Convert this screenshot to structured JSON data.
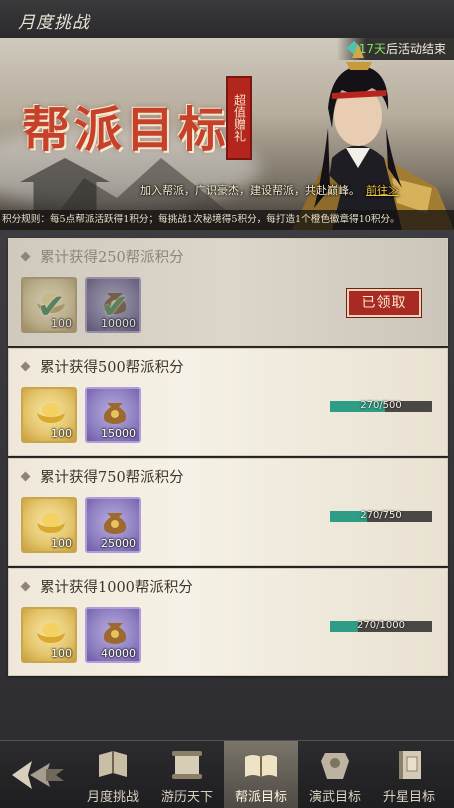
{
  "header": {
    "title": "月度挑战"
  },
  "banner": {
    "timer_days": "17天",
    "timer_text": "后活动结束",
    "title": "帮派目标",
    "seal": "超值赠礼",
    "slogan": "加入帮派，广识豪杰，建设帮派，共赴巅峰。",
    "goto": "前往≫",
    "rules": "积分规则：每5点帮派活跃得1积分；每挑战1次秘境得5积分，每打造1个橙色徽章得10积分。"
  },
  "tasks": [
    {
      "label": "累计获得250帮派积分",
      "rewards": [
        {
          "type": "gold",
          "qty": "100"
        },
        {
          "type": "bag",
          "qty": "10000"
        }
      ],
      "claimed": true,
      "claimed_text": "已领取"
    },
    {
      "label": "累计获得500帮派积分",
      "rewards": [
        {
          "type": "gold",
          "qty": "100"
        },
        {
          "type": "bag",
          "qty": "15000"
        }
      ],
      "claimed": false,
      "progress_text": "270/500",
      "progress": 0.54
    },
    {
      "label": "累计获得750帮派积分",
      "rewards": [
        {
          "type": "gold",
          "qty": "100"
        },
        {
          "type": "bag",
          "qty": "25000"
        }
      ],
      "claimed": false,
      "progress_text": "270/750",
      "progress": 0.36
    },
    {
      "label": "累计获得1000帮派积分",
      "rewards": [
        {
          "type": "gold",
          "qty": "100"
        },
        {
          "type": "bag",
          "qty": "40000"
        }
      ],
      "claimed": false,
      "progress_text": "270/1000",
      "progress": 0.27
    }
  ],
  "nav": {
    "tabs": [
      {
        "label": "月度挑战",
        "icon": "book-icon"
      },
      {
        "label": "游历天下",
        "icon": "scroll-icon"
      },
      {
        "label": "帮派目标",
        "icon": "open-book-icon",
        "active": true
      },
      {
        "label": "演武目标",
        "icon": "armor-icon"
      },
      {
        "label": "升星目标",
        "icon": "manual-icon"
      }
    ]
  },
  "colors": {
    "progress_fill": "#2f9c86",
    "title_red": "#c7412a",
    "timer_green": "#7fe06a"
  }
}
